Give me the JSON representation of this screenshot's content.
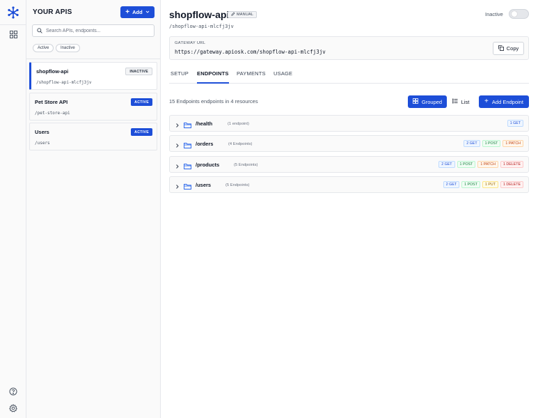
{
  "sidebar": {
    "title": "YOUR APIS",
    "add_label": "Add",
    "search_placeholder": "Search APIs, endpoints...",
    "filters": [
      "Active",
      "Inactive"
    ],
    "apis": [
      {
        "name": "shopflow-api",
        "path": "/shopflow-api-mlcfj3jv",
        "status": "INACTIVE"
      },
      {
        "name": "Pet Store API",
        "path": "/pet-store-api",
        "status": "ACTIVE"
      },
      {
        "name": "Users",
        "path": "/users",
        "status": "ACTIVE"
      }
    ]
  },
  "api": {
    "name": "shopflow-api",
    "mode_badge": "MANUAL",
    "path": "/shopflow-api-mlcfj3jv",
    "status_label": "Inactive",
    "gateway_label": "GATEWAY URL",
    "gateway_url": "https://gateway.apiosk.com/shopflow-api-mlcfj3jv",
    "copy_label": "Copy"
  },
  "tabs": [
    "SETUP",
    "ENDPOINTS",
    "PAYMENTS",
    "USAGE"
  ],
  "selected_tab": "ENDPOINTS",
  "endpoints": {
    "summary": "15 Endpoints endpoints in 4 resources",
    "grouped_label": "Grouped",
    "list_label": "List",
    "add_label": "Add Endpoint",
    "resources": [
      {
        "path": "/health",
        "count": "(1 endpoint)",
        "methods": [
          {
            "label": "1 GET",
            "kind": "get"
          }
        ]
      },
      {
        "path": "/orders",
        "count": "(4 Endpoints)",
        "methods": [
          {
            "label": "2 GET",
            "kind": "get"
          },
          {
            "label": "1 POST",
            "kind": "post"
          },
          {
            "label": "1 PATCH",
            "kind": "patch"
          }
        ]
      },
      {
        "path": "/products",
        "count": "(5 Endpoints)",
        "methods": [
          {
            "label": "2 GET",
            "kind": "get"
          },
          {
            "label": "1 POST",
            "kind": "post"
          },
          {
            "label": "1 PATCH",
            "kind": "patch"
          },
          {
            "label": "1 DELETE",
            "kind": "delete"
          }
        ]
      },
      {
        "path": "/users",
        "count": "(5 Endpoints)",
        "methods": [
          {
            "label": "2 GET",
            "kind": "get"
          },
          {
            "label": "1 POST",
            "kind": "post"
          },
          {
            "label": "1 PUT",
            "kind": "put"
          },
          {
            "label": "1 DELETE",
            "kind": "delete"
          }
        ]
      }
    ]
  },
  "colors": {
    "accent": "#1d4ed8"
  },
  "icons": [
    "logo-icon",
    "dashboard-icon",
    "help-icon",
    "settings-icon",
    "plus-icon",
    "chevron-down-icon",
    "search-icon",
    "pencil-icon",
    "copy-icon",
    "grid-icon",
    "list-icon",
    "chevron-right-icon",
    "folder-icon"
  ]
}
